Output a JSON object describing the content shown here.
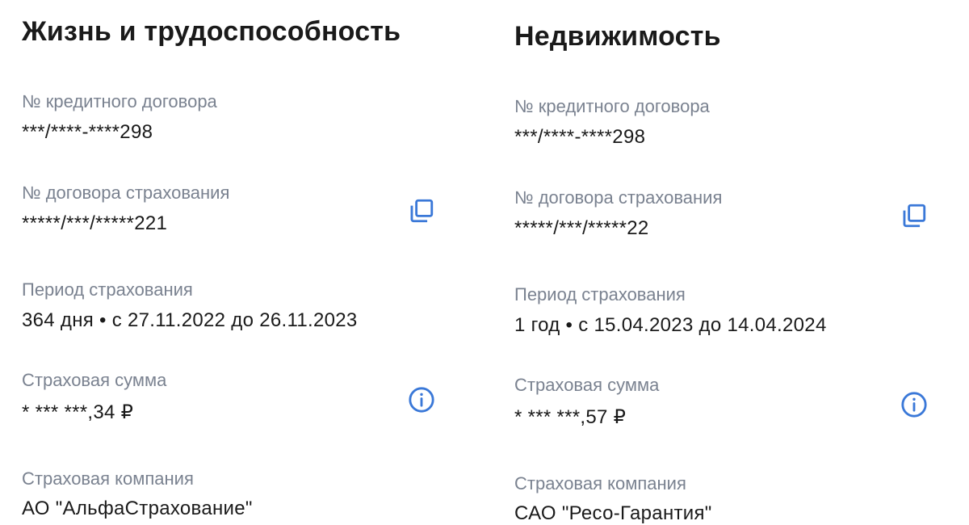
{
  "colors": {
    "label": "#7a8290",
    "value": "#1a1a1a",
    "accent": "#3a78d8"
  },
  "panels": [
    {
      "title": "Жизнь и трудоспособность",
      "credit_label": "№ кредитного договора",
      "credit_value": "***/****-****298",
      "policy_label": "№ договора страхования",
      "policy_value": "*****/***/*****221",
      "period_label": "Период страхования",
      "period_value": "364 дня • с 27.11.2022 до 26.11.2023",
      "sum_label": "Страховая сумма",
      "sum_value": "* *** ***,34 ₽",
      "company_label": "Страховая компания",
      "company_value": "АО \"АльфаСтрахование\"",
      "copy_icon": "copy-icon",
      "info_icon": "info-icon"
    },
    {
      "title": "Недвижимость",
      "credit_label": "№ кредитного договора",
      "credit_value": "***/****-****298",
      "policy_label": "№ договора страхования",
      "policy_value": "*****/***/*****22",
      "period_label": "Период страхования",
      "period_value": "1 год • с 15.04.2023 до 14.04.2024",
      "sum_label": "Страховая сумма",
      "sum_value": "* *** ***,57 ₽",
      "company_label": "Страховая компания",
      "company_value": "САО \"Ресо-Гарантия\"",
      "copy_icon": "copy-icon",
      "info_icon": "info-icon"
    }
  ]
}
